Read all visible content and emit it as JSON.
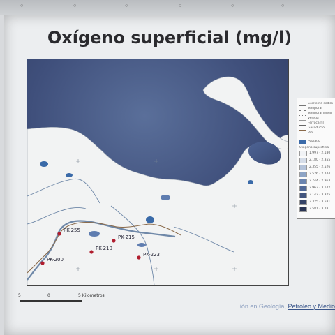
{
  "slide": {
    "title": "Oxígeno superficial (mg/l)"
  },
  "map": {
    "stations": [
      {
        "id": "pk-255",
        "label": "PK-255"
      },
      {
        "id": "pk-215",
        "label": "PK-215"
      },
      {
        "id": "pk-210",
        "label": "PK-210"
      },
      {
        "id": "pk-200",
        "label": "PK-200"
      },
      {
        "id": "pk-223",
        "label": "PK-223"
      }
    ],
    "colors": {
      "water_deep": "#3d4a73",
      "water_light": "#6b85b3",
      "land": "#f2f3f3",
      "river": "#6f88a8",
      "route": "#8a6a4a",
      "station": "#b01d2e"
    },
    "scalebar": {
      "labels": [
        "5",
        "0",
        "5 Kilometros"
      ]
    }
  },
  "legend": {
    "line_items": [
      {
        "label": "Corriente sedim"
      },
      {
        "label": "Temporal"
      },
      {
        "label": "Temporal lineal"
      },
      {
        "label": "Vereda"
      },
      {
        "label": "Ferrocarril"
      },
      {
        "label": "Gasoducto"
      },
      {
        "label": "Rio"
      }
    ],
    "area_item": {
      "label": "Poblado",
      "color": "#3a6aa8"
    },
    "ramp_title": "Oxigeno superficial",
    "ramp": [
      {
        "range": "1.997 - 2.180",
        "color": "#f1f3f6"
      },
      {
        "range": "2.180 - 2.355",
        "color": "#d5dde9"
      },
      {
        "range": "2.355 - 2.526",
        "color": "#b4c3da"
      },
      {
        "range": "2.526 - 2.744",
        "color": "#8da4c6"
      },
      {
        "range": "2.744 - 2.963",
        "color": "#6b85b0"
      },
      {
        "range": "2.963 - 3.142",
        "color": "#526a98"
      },
      {
        "range": "3.142 - 3.325",
        "color": "#42557f"
      },
      {
        "range": "3.325 - 3.581",
        "color": "#354468"
      },
      {
        "range": "3.581 - 3.78",
        "color": "#2a3554"
      }
    ]
  },
  "footer": {
    "prefix": "ión en Geología, ",
    "highlight": "Petróleo y Medio"
  }
}
